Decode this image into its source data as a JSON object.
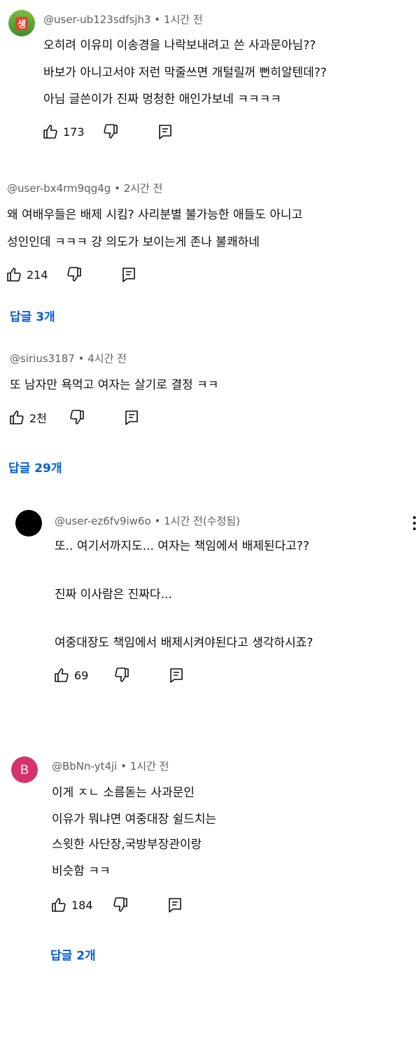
{
  "comments": [
    {
      "username": "@user-ub123sdfsjh3",
      "time": "1시간 전",
      "lines": [
        "오히려 이유미 이송경을 나락보내려고 쓴 사과문아님??",
        "바보가 아니고서야 저런 막줄쓰면 개털릴꺼 뻔히알텐데??",
        "아님 글쓴이가 진짜 멍청한 애인가보네 ㅋㅋㅋㅋ"
      ],
      "likes": "173",
      "avatar_text": "생"
    },
    {
      "username": "@user-bx4rm9qg4g",
      "time": "2시간 전",
      "lines": [
        "왜 여배우들은 배제 시킴? 사리분별 불가능한 애들도 아니고",
        "성인인데 ㅋㅋㅋ 걍 의도가 보이는게 존나 불쾌하네"
      ],
      "likes": "214",
      "replies_label": "답글 3개"
    },
    {
      "username": "@sirius3187",
      "time": "4시간 전",
      "lines": [
        "또 남자만 욕먹고 여자는 살기로 결정 ㅋㅋ"
      ],
      "likes": "2천",
      "replies_label": "답글 29개"
    }
  ],
  "replies": [
    {
      "username": "@user-ez6fv9iw6o",
      "time": "1시간 전(수정됨)",
      "lines": [
        "또.. 여기서까지도... 여자는 책임에서 배제된다고??",
        "",
        "진짜 이사람은 진짜다...",
        "",
        "여중대장도 책임에서 배제시켜야된다고 생각하시죠?"
      ],
      "likes": "69"
    },
    {
      "username": "@BbNn-yt4ji",
      "time": "1시간 전",
      "avatar_letter": "B",
      "lines": [
        "이게 ㅈㄴ 소름돋는 사과문인",
        "이유가 뭐냐면 여중대장 쉴드치는",
        "스윗한 사단장,국방부장관이랑",
        "비슷함 ㅋㅋ"
      ],
      "likes": "184",
      "replies_label": "답글 2개"
    }
  ],
  "separator": "•",
  "colors": {
    "text": "#0f0f0f",
    "meta": "#606060",
    "link": "#065fd4",
    "avatar_b": "#d6336c"
  },
  "icons": [
    "like-icon",
    "dislike-icon",
    "reply-icon",
    "more-vert-icon"
  ]
}
